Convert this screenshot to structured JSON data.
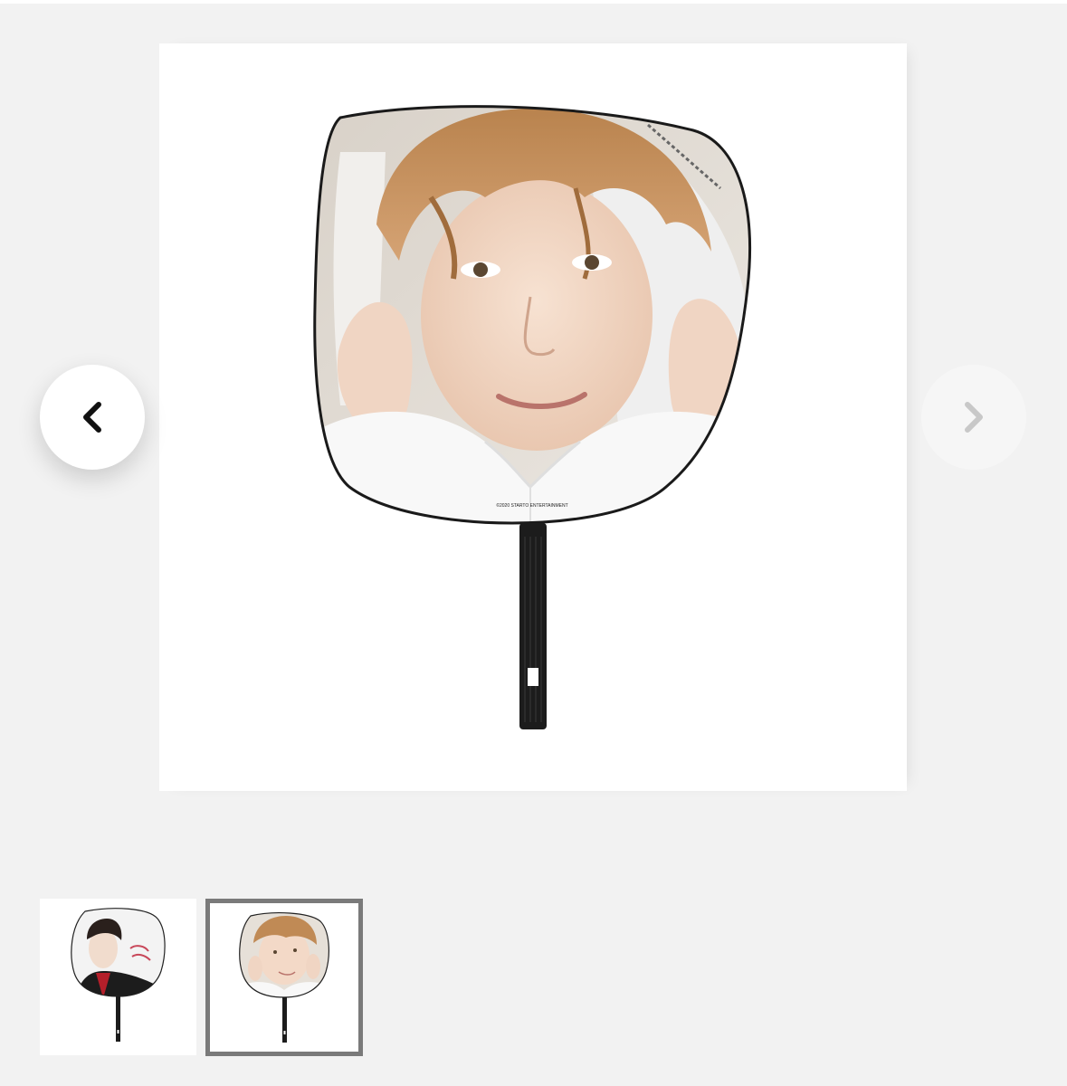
{
  "gallery": {
    "main_image": {
      "subject": "image-fan-uchiwa-close-up-portrait",
      "copyright_text": "©2020 STARTO ENTERTAINMENT"
    },
    "prev_button": {
      "icon": "chevron-left-icon",
      "color": "#111111"
    },
    "next_button": {
      "icon": "chevron-right-icon",
      "color": "#c8c8c8"
    },
    "thumbnails": [
      {
        "subject": "image-fan-uchiwa-red-jacket",
        "selected": false
      },
      {
        "subject": "image-fan-uchiwa-close-up-portrait",
        "selected": true
      }
    ],
    "colors": {
      "page_background": "#f2f2f2",
      "card_background": "#ffffff",
      "selected_border": "#7a7a7a",
      "fan_rim": "#1a1a1a",
      "handle": "#1c1c1c"
    }
  }
}
